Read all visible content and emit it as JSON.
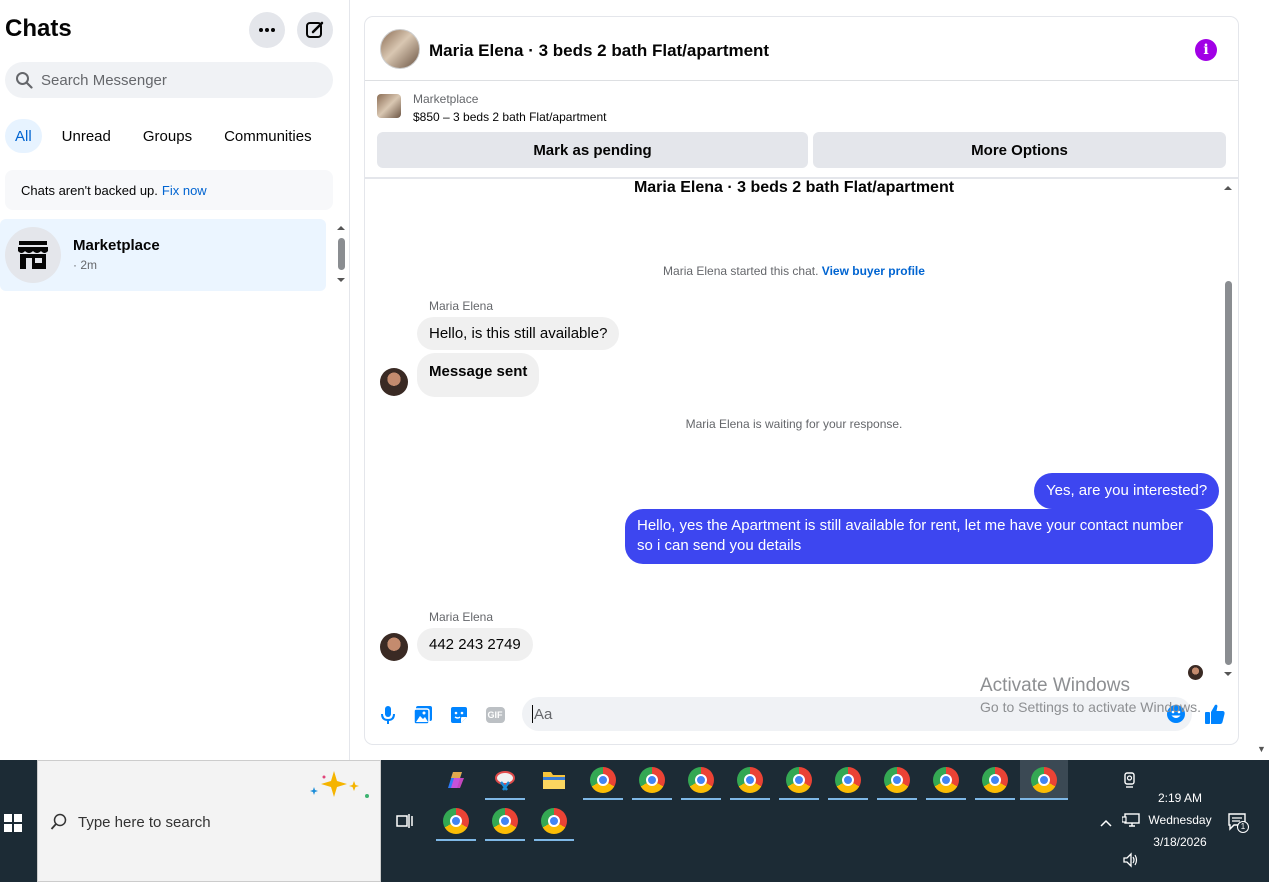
{
  "sidebar": {
    "title": "Chats",
    "more_icon": "more-horizontal-icon",
    "compose_icon": "compose-icon",
    "search_placeholder": "Search Messenger",
    "tabs": [
      {
        "label": "All",
        "active": true
      },
      {
        "label": "Unread",
        "active": false
      },
      {
        "label": "Groups",
        "active": false
      },
      {
        "label": "Communities",
        "active": false
      }
    ],
    "backup_notice": "Chats aren't backed up.",
    "backup_link": "Fix now",
    "chats": [
      {
        "name": "Marketplace",
        "time": "· 2m",
        "icon": "storefront-icon"
      }
    ]
  },
  "header": {
    "title": "Maria Elena · 3 beds 2 bath Flat/apartment",
    "info_icon": "info-icon",
    "accent": "#a100e6"
  },
  "listing": {
    "label": "Marketplace",
    "price_line": "$850 – 3 beds 2 bath Flat/apartment",
    "mark_pending": "Mark as pending",
    "more_options": "More Options"
  },
  "conversation": {
    "title": "Maria Elena · 3 beds 2 bath Flat/apartment",
    "started_text": "Maria Elena started this chat.",
    "view_profile": "View buyer profile",
    "sender_1": "Maria Elena",
    "msg_in_1": "Hello, is this still available?",
    "msg_in_2": "Message sent",
    "waiting_text": "Maria Elena is waiting for your response.",
    "msg_out_1": "Yes, are you interested?",
    "msg_out_2": "Hello, yes the Apartment is still available for rent, let me have your contact number so i can send you details",
    "sender_2": "Maria Elena",
    "msg_in_3": "442 243 2749",
    "outgoing_color": "#3d46f0"
  },
  "composer": {
    "placeholder": "Aa",
    "icons": [
      "microphone-icon",
      "photo-icon",
      "sticker-icon",
      "gif-icon",
      "emoji-icon",
      "thumbs-up-icon"
    ],
    "gif_label": "GIF",
    "accent": "#0084ff"
  },
  "watermark": {
    "line1": "Activate Windows",
    "line2": "Go to Settings to activate Windows."
  },
  "taskbar": {
    "search_placeholder": "Type here to search",
    "time": "2:19 AM",
    "day": "Wednesday",
    "date": "3/18/2026",
    "notification_count": "1"
  }
}
